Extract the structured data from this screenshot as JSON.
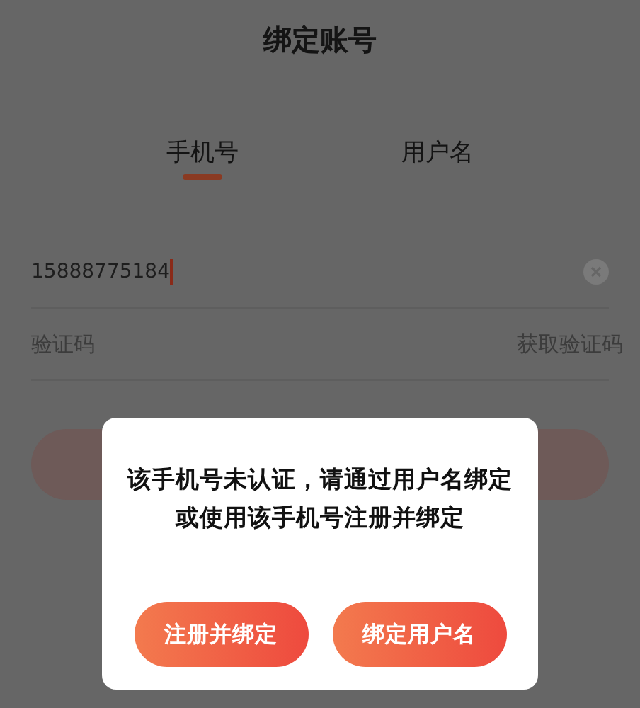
{
  "title": "绑定账号",
  "tabs": [
    {
      "label": "手机号",
      "selected": true
    },
    {
      "label": "用户名",
      "selected": false
    }
  ],
  "phone_field": {
    "value": "15888775184"
  },
  "code_field": {
    "placeholder": "验证码",
    "action": "获取验证码"
  },
  "dialog": {
    "message": "该手机号未认证，请通过用户名绑定或使用该手机号注册并绑定",
    "buttons": [
      "注册并绑定",
      "绑定用户名"
    ]
  }
}
